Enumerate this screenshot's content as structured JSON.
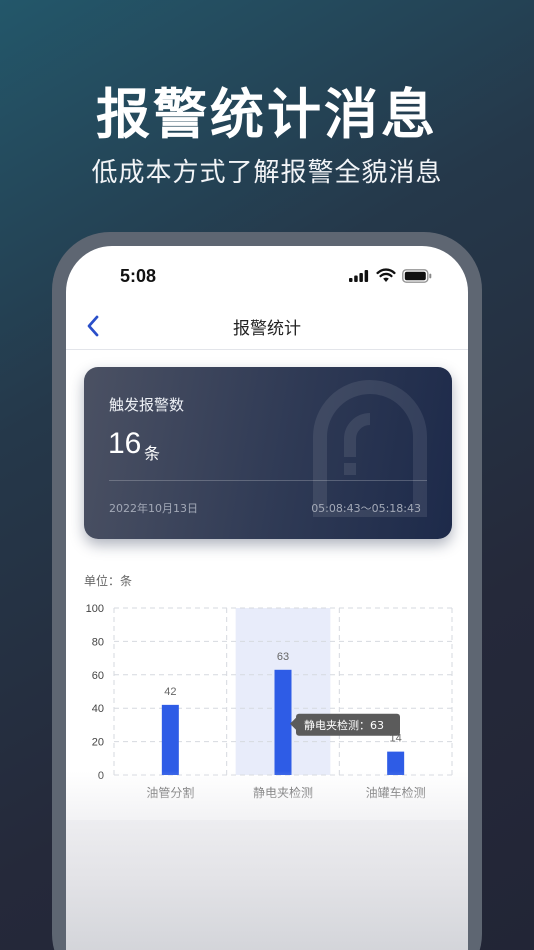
{
  "promo": {
    "headline": "报警统计消息",
    "subline": "低成本方式了解报警全貌消息"
  },
  "status_bar": {
    "time": "5:08",
    "icons": [
      "signal-icon",
      "wifi-icon",
      "battery-icon"
    ]
  },
  "nav": {
    "title": "报警统计",
    "back_icon": "chevron-left-icon"
  },
  "summary_card": {
    "label": "触发报警数",
    "count": "16",
    "unit": "条",
    "date": "2022年10月13日",
    "time_range": "05:08:43～05:18:43"
  },
  "chart": {
    "unit_label": "单位：条"
  },
  "chart_data": {
    "type": "bar",
    "categories": [
      "油管分割",
      "静电夹检测",
      "油罐车检测"
    ],
    "values": [
      42,
      63,
      14
    ],
    "ylim": [
      0,
      100
    ],
    "yticks": [
      "100",
      "80",
      "60",
      "40",
      "20",
      "0"
    ],
    "grid": true,
    "highlighted_category": "静电夹检测",
    "tooltip": "静电夹检测：63",
    "bar_color": "#2e5ce6",
    "highlight_color": "#e8ecfa"
  },
  "colors": {
    "accent": "#2e5ce6",
    "card_bg": "#2f3a55"
  }
}
